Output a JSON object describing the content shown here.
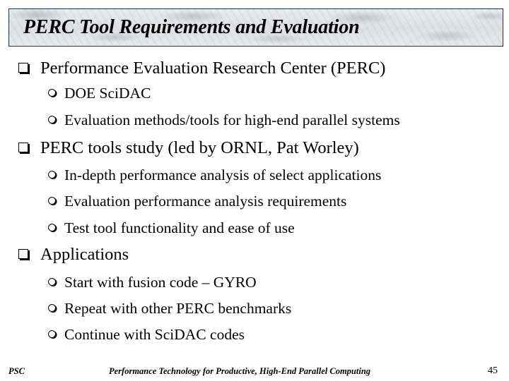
{
  "slide": {
    "title": "PERC Tool Requirements and Evaluation",
    "sections": [
      {
        "label": "Performance Evaluation Research Center (PERC)",
        "items": [
          "DOE SciDAC",
          "Evaluation methods/tools for high-end parallel systems"
        ]
      },
      {
        "label": "PERC tools study (led by ORNL, Pat Worley)",
        "items": [
          "In-depth performance analysis of select applications",
          "Evaluation performance analysis requirements",
          "Test tool functionality and ease of use"
        ]
      },
      {
        "label": "Applications",
        "items": [
          "Start with fusion code – GYRO",
          "Repeat with other PERC benchmarks",
          "Continue with SciDAC codes"
        ]
      }
    ],
    "bullet_icons": {
      "main": "shadowed-box-bullet-icon",
      "sub": "shadowed-circle-bullet-icon"
    }
  },
  "footer": {
    "left": "PSC",
    "center": "Performance Technology for Productive, High-End Parallel Computing",
    "page_number": "45"
  },
  "colors": {
    "title_border": "#1f3045",
    "text": "#000000",
    "background": "#ffffff"
  }
}
